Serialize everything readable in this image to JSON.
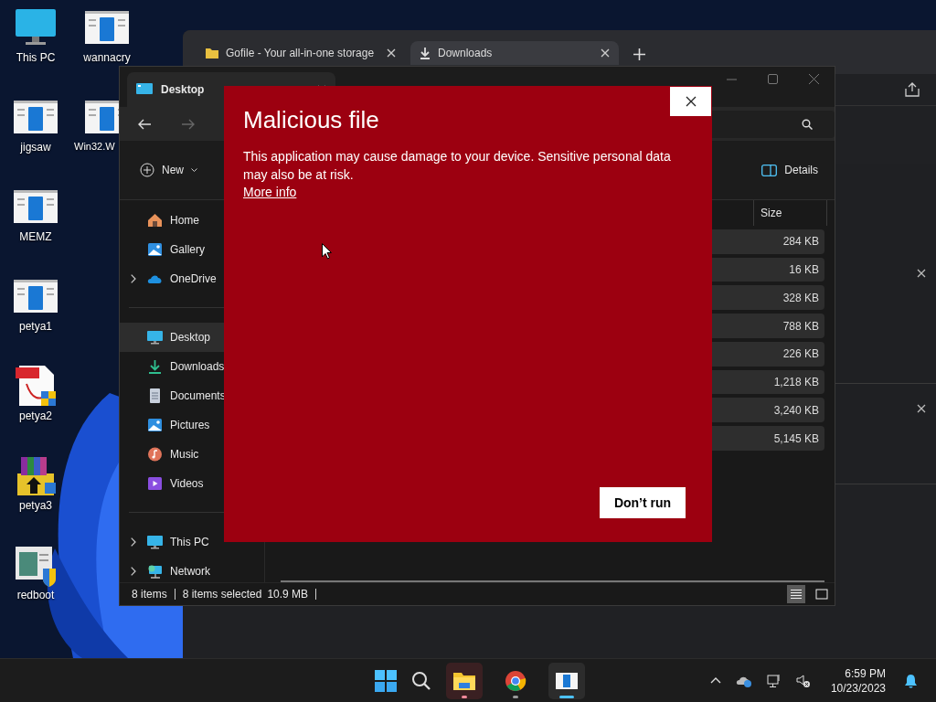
{
  "desktop_icons": [
    {
      "label": "This PC",
      "kind": "pc"
    },
    {
      "label": "wannacry",
      "kind": "app"
    },
    {
      "label": "jigsaw",
      "kind": "app"
    },
    {
      "label": "Win32.W",
      "kind": "app"
    },
    {
      "label": "MEMZ",
      "kind": "app"
    },
    {
      "label": "petya1",
      "kind": "app"
    },
    {
      "label": "petya2",
      "kind": "pdf"
    },
    {
      "label": "petya3",
      "kind": "archive"
    },
    {
      "label": "redboot",
      "kind": "installer"
    }
  ],
  "browser": {
    "tabs": [
      {
        "title": "Gofile - Your all-in-one storage",
        "selected": false
      },
      {
        "title": "Downloads",
        "selected": true
      }
    ]
  },
  "explorer": {
    "tab_title": "Desktop",
    "new_button": "New",
    "details_button": "Details",
    "size_header": "Size",
    "sidebar": [
      [
        {
          "label": "Home",
          "kind": "home",
          "collapsible": false,
          "selected": false
        },
        {
          "label": "Gallery",
          "kind": "gallery",
          "collapsible": false,
          "selected": false
        },
        {
          "label": "OneDrive",
          "kind": "onedrive",
          "collapsible": true,
          "selected": false
        }
      ],
      [
        {
          "label": "Desktop",
          "kind": "desktop",
          "collapsible": false,
          "selected": true
        },
        {
          "label": "Downloads",
          "kind": "downloads",
          "collapsible": false,
          "selected": false
        },
        {
          "label": "Documents",
          "kind": "documents",
          "collapsible": false,
          "selected": false
        },
        {
          "label": "Pictures",
          "kind": "pictures",
          "collapsible": false,
          "selected": false
        },
        {
          "label": "Music",
          "kind": "music",
          "collapsible": false,
          "selected": false
        },
        {
          "label": "Videos",
          "kind": "videos",
          "collapsible": false,
          "selected": false
        }
      ],
      [
        {
          "label": "This PC",
          "kind": "pc",
          "collapsible": true,
          "selected": false
        },
        {
          "label": "Network",
          "kind": "network",
          "collapsible": true,
          "selected": false
        }
      ]
    ],
    "files": [
      {
        "size": "284 KB",
        "selected": true
      },
      {
        "size": "16 KB",
        "selected": true
      },
      {
        "size": "328 KB",
        "selected": true
      },
      {
        "size": "788 KB",
        "selected": true
      },
      {
        "size": "226 KB",
        "selected": true
      },
      {
        "size": "1,218 KB",
        "selected": true
      },
      {
        "size": "3,240 KB",
        "selected": true
      },
      {
        "size": "5,145 KB",
        "selected": true
      }
    ],
    "status_bar": {
      "item_count": "8 items",
      "selection": "8 items selected",
      "selection_size": "10.9 MB"
    },
    "view_modes": [
      {
        "kind": "details",
        "selected": true
      },
      {
        "kind": "tiles",
        "selected": false
      }
    ]
  },
  "dialog": {
    "title": "Malicious file",
    "message": "This application may cause damage to your device. Sensitive personal data may also be at risk.",
    "link": "More info",
    "button": "Don’t run"
  },
  "taskbar": {
    "apps": [
      {
        "kind": "explorer",
        "attention": true,
        "selected": false
      },
      {
        "kind": "chrome",
        "attention": false,
        "selected": false
      },
      {
        "kind": "app",
        "attention": false,
        "selected": true
      }
    ],
    "clock": {
      "time": "6:59 PM",
      "date": "10/23/2023"
    }
  }
}
